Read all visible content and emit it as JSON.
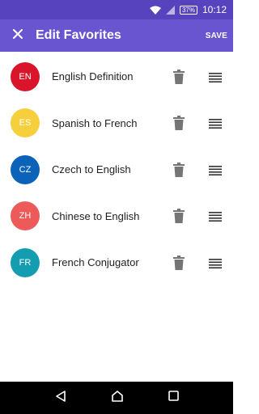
{
  "status_bar": {
    "battery": "37%",
    "time": "10:12"
  },
  "app_bar": {
    "title": "Edit Favorites",
    "save_label": "SAVE"
  },
  "items": [
    {
      "code": "EN",
      "label": "English Definition",
      "color": "#d9152b"
    },
    {
      "code": "ES",
      "label": "Spanish to French",
      "color": "#f6cf3c"
    },
    {
      "code": "CZ",
      "label": "Czech to English",
      "color": "#0a63b8"
    },
    {
      "code": "ZH",
      "label": "Chinese to English",
      "color": "#ed5a5a"
    },
    {
      "code": "FR",
      "label": "French Conjugator",
      "color": "#149db0"
    }
  ],
  "icons": {
    "close": "close-icon",
    "delete": "trash-icon",
    "reorder": "drag-handle-icon",
    "back": "back-icon",
    "home": "home-icon",
    "recents": "recents-icon"
  }
}
